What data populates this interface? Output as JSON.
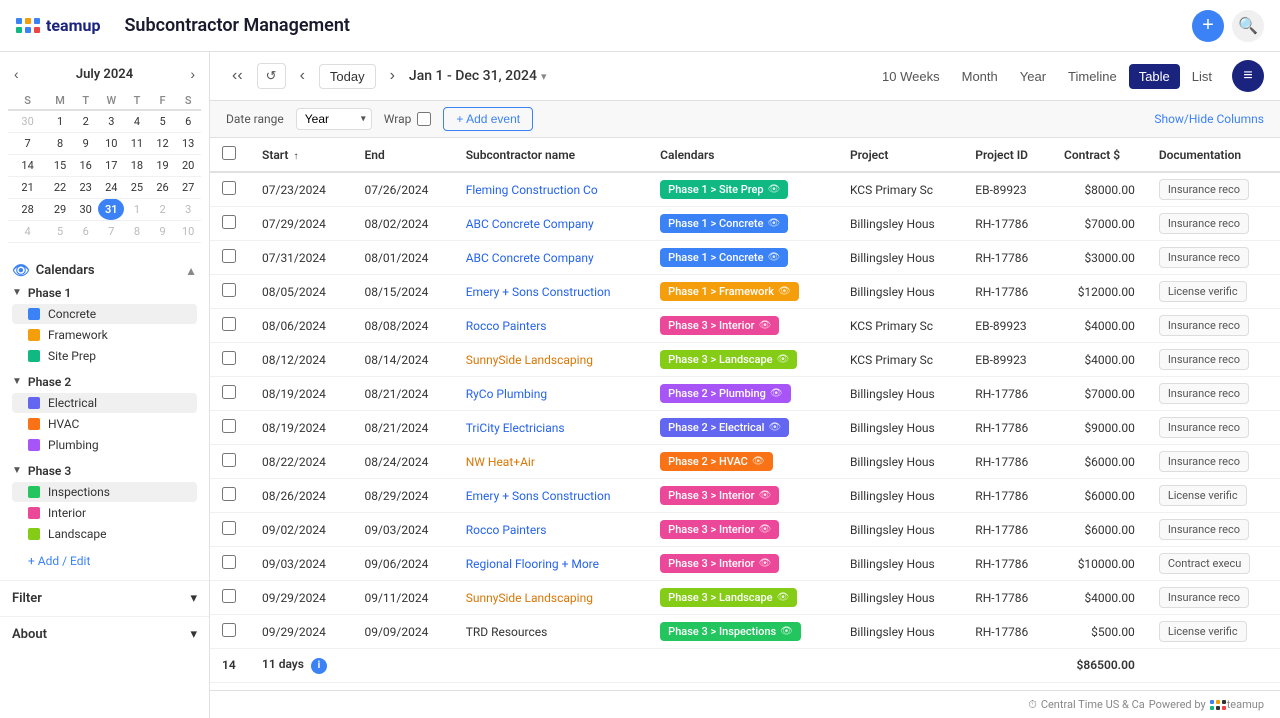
{
  "app": {
    "logo_text": "teamup",
    "title": "Subcontractor Management"
  },
  "header": {
    "add_btn": "+",
    "search_btn": "🔍"
  },
  "mini_calendar": {
    "month": "July",
    "year": "2024",
    "days_header": [
      "S",
      "M",
      "T",
      "W",
      "T",
      "F",
      "S"
    ],
    "weeks": [
      [
        {
          "d": "30",
          "other": true
        },
        {
          "d": "1"
        },
        {
          "d": "2"
        },
        {
          "d": "3"
        },
        {
          "d": "4"
        },
        {
          "d": "5"
        },
        {
          "d": "6"
        }
      ],
      [
        {
          "d": "7"
        },
        {
          "d": "8"
        },
        {
          "d": "9"
        },
        {
          "d": "10"
        },
        {
          "d": "11"
        },
        {
          "d": "12"
        },
        {
          "d": "13"
        }
      ],
      [
        {
          "d": "14"
        },
        {
          "d": "15"
        },
        {
          "d": "16"
        },
        {
          "d": "17"
        },
        {
          "d": "18"
        },
        {
          "d": "19"
        },
        {
          "d": "20"
        }
      ],
      [
        {
          "d": "21"
        },
        {
          "d": "22"
        },
        {
          "d": "23"
        },
        {
          "d": "24"
        },
        {
          "d": "25"
        },
        {
          "d": "26"
        },
        {
          "d": "27"
        }
      ],
      [
        {
          "d": "28"
        },
        {
          "d": "29"
        },
        {
          "d": "30"
        },
        {
          "d": "31",
          "today": true
        },
        {
          "d": "1",
          "other": true
        },
        {
          "d": "2",
          "other": true
        },
        {
          "d": "3",
          "other": true
        }
      ],
      [
        {
          "d": "4",
          "other": true
        },
        {
          "d": "5",
          "other": true
        },
        {
          "d": "6",
          "other": true
        },
        {
          "d": "7",
          "other": true
        },
        {
          "d": "8",
          "other": true
        },
        {
          "d": "9",
          "other": true
        },
        {
          "d": "10",
          "other": true
        }
      ]
    ]
  },
  "sidebar": {
    "calendars_title": "Calendars",
    "phase1_label": "Phase 1",
    "phase1_items": [
      {
        "label": "Concrete",
        "color": "phase1-concrete"
      },
      {
        "label": "Framework",
        "color": "phase1-framework"
      },
      {
        "label": "Site Prep",
        "color": "phase1-siteprep"
      }
    ],
    "phase2_label": "Phase 2",
    "phase2_items": [
      {
        "label": "Electrical",
        "color": "phase2-electrical"
      },
      {
        "label": "HVAC",
        "color": "phase2-hvac"
      },
      {
        "label": "Plumbing",
        "color": "phase2-plumbing"
      }
    ],
    "phase3_label": "Phase 3",
    "phase3_items": [
      {
        "label": "Inspections",
        "color": "phase3-inspections"
      },
      {
        "label": "Interior",
        "color": "phase3-interior"
      },
      {
        "label": "Landscape",
        "color": "phase3-landscape"
      }
    ],
    "add_edit_label": "+ Add / Edit",
    "filter_label": "Filter",
    "about_label": "About"
  },
  "toolbar": {
    "today_label": "Today",
    "date_range": "Jan 1 - Dec 31, 2024",
    "view_10weeks": "10 Weeks",
    "view_month": "Month",
    "view_year": "Year",
    "view_timeline": "Timeline",
    "view_table": "Table",
    "view_list": "List"
  },
  "date_range_bar": {
    "date_range_label": "Date range",
    "date_range_value": "Year",
    "wrap_label": "Wrap",
    "add_event_label": "+ Add event",
    "show_hide_label": "Show/Hide Columns"
  },
  "table": {
    "columns": [
      "Start ↑",
      "End",
      "Subcontractor name",
      "Calendars",
      "Project",
      "Project ID",
      "Contract $",
      "Documentation"
    ],
    "rows": [
      {
        "start": "07/23/2024",
        "end": "07/26/2024",
        "sub": "Fleming Construction Co",
        "sub_color": "#2563eb",
        "calendar": "Phase 1 > Site Prep",
        "cal_class": "phase1-siteprep",
        "project": "KCS Primary Sc",
        "project_id": "EB-89923",
        "contract": "$8000.00",
        "doc": "Insurance reco"
      },
      {
        "start": "07/29/2024",
        "end": "08/02/2024",
        "sub": "ABC Concrete Company",
        "sub_color": "#2563eb",
        "calendar": "Phase 1 > Concrete",
        "cal_class": "phase1-concrete",
        "project": "Billingsley Hous",
        "project_id": "RH-17786",
        "contract": "$7000.00",
        "doc": "Insurance reco"
      },
      {
        "start": "07/31/2024",
        "end": "08/01/2024",
        "sub": "ABC Concrete Company",
        "sub_color": "#2563eb",
        "calendar": "Phase 1 > Concrete",
        "cal_class": "phase1-concrete",
        "project": "Billingsley Hous",
        "project_id": "RH-17786",
        "contract": "$3000.00",
        "doc": "Insurance reco"
      },
      {
        "start": "08/05/2024",
        "end": "08/15/2024",
        "sub": "Emery + Sons Construction",
        "sub_color": "#2563eb",
        "calendar": "Phase 1 > Framework",
        "cal_class": "phase1-framework",
        "project": "Billingsley Hous",
        "project_id": "RH-17786",
        "contract": "$12000.00",
        "doc": "License verific"
      },
      {
        "start": "08/06/2024",
        "end": "08/08/2024",
        "sub": "Rocco Painters",
        "sub_color": "#2563eb",
        "calendar": "Phase 3 > Interior",
        "cal_class": "phase3-interior",
        "project": "KCS Primary Sc",
        "project_id": "EB-89923",
        "contract": "$4000.00",
        "doc": "Insurance reco"
      },
      {
        "start": "08/12/2024",
        "end": "08/14/2024",
        "sub": "SunnySide Landscaping",
        "sub_color": "#d97706",
        "calendar": "Phase 3 > Landscape",
        "cal_class": "phase3-landscape",
        "project": "KCS Primary Sc",
        "project_id": "EB-89923",
        "contract": "$4000.00",
        "doc": "Insurance reco"
      },
      {
        "start": "08/19/2024",
        "end": "08/21/2024",
        "sub": "RyCo Plumbing",
        "sub_color": "#2563eb",
        "calendar": "Phase 2 > Plumbing",
        "cal_class": "phase2-plumbing",
        "project": "Billingsley Hous",
        "project_id": "RH-17786",
        "contract": "$7000.00",
        "doc": "Insurance reco"
      },
      {
        "start": "08/19/2024",
        "end": "08/21/2024",
        "sub": "TriCity Electricians",
        "sub_color": "#2563eb",
        "calendar": "Phase 2 > Electrical",
        "cal_class": "phase2-electrical",
        "project": "Billingsley Hous",
        "project_id": "RH-17786",
        "contract": "$9000.00",
        "doc": "Insurance reco"
      },
      {
        "start": "08/22/2024",
        "end": "08/24/2024",
        "sub": "NW Heat+Air",
        "sub_color": "#d97706",
        "calendar": "Phase 2 > HVAC",
        "cal_class": "phase2-hvac",
        "project": "Billingsley Hous",
        "project_id": "RH-17786",
        "contract": "$6000.00",
        "doc": "Insurance reco"
      },
      {
        "start": "08/26/2024",
        "end": "08/29/2024",
        "sub": "Emery + Sons Construction",
        "sub_color": "#2563eb",
        "calendar": "Phase 3 > Interior",
        "cal_class": "phase3-interior",
        "project": "Billingsley Hous",
        "project_id": "RH-17786",
        "contract": "$6000.00",
        "doc": "License verific"
      },
      {
        "start": "09/02/2024",
        "end": "09/03/2024",
        "sub": "Rocco Painters",
        "sub_color": "#2563eb",
        "calendar": "Phase 3 > Interior",
        "cal_class": "phase3-interior",
        "project": "Billingsley Hous",
        "project_id": "RH-17786",
        "contract": "$6000.00",
        "doc": "Insurance reco"
      },
      {
        "start": "09/03/2024",
        "end": "09/06/2024",
        "sub": "Regional Flooring + More",
        "sub_color": "#2563eb",
        "calendar": "Phase 3 > Interior",
        "cal_class": "phase3-interior",
        "project": "Billingsley Hous",
        "project_id": "RH-17786",
        "contract": "$10000.00",
        "doc": "Contract execu"
      },
      {
        "start": "09/29/2024",
        "end": "09/11/2024",
        "sub": "SunnySide Landscaping",
        "sub_color": "#d97706",
        "calendar": "Phase 3 > Landscape",
        "cal_class": "phase3-landscape",
        "project": "Billingsley Hous",
        "project_id": "RH-17786",
        "contract": "$4000.00",
        "doc": "Insurance reco"
      },
      {
        "start": "09/29/2024",
        "end": "09/09/2024",
        "sub": "TRD Resources",
        "sub_color": "#333",
        "calendar": "Phase 3 > Inspections",
        "cal_class": "phase3-inspections",
        "project": "Billingsley Hous",
        "project_id": "RH-17786",
        "contract": "$500.00",
        "doc": "License verific"
      }
    ],
    "footer": {
      "count": "14",
      "days": "11 days",
      "total": "$86500.00"
    }
  },
  "bottom_bar": {
    "timezone_icon": "⏱",
    "timezone": "Central Time US & Ca",
    "powered_by": "Powered by",
    "teamup": "teamup"
  }
}
